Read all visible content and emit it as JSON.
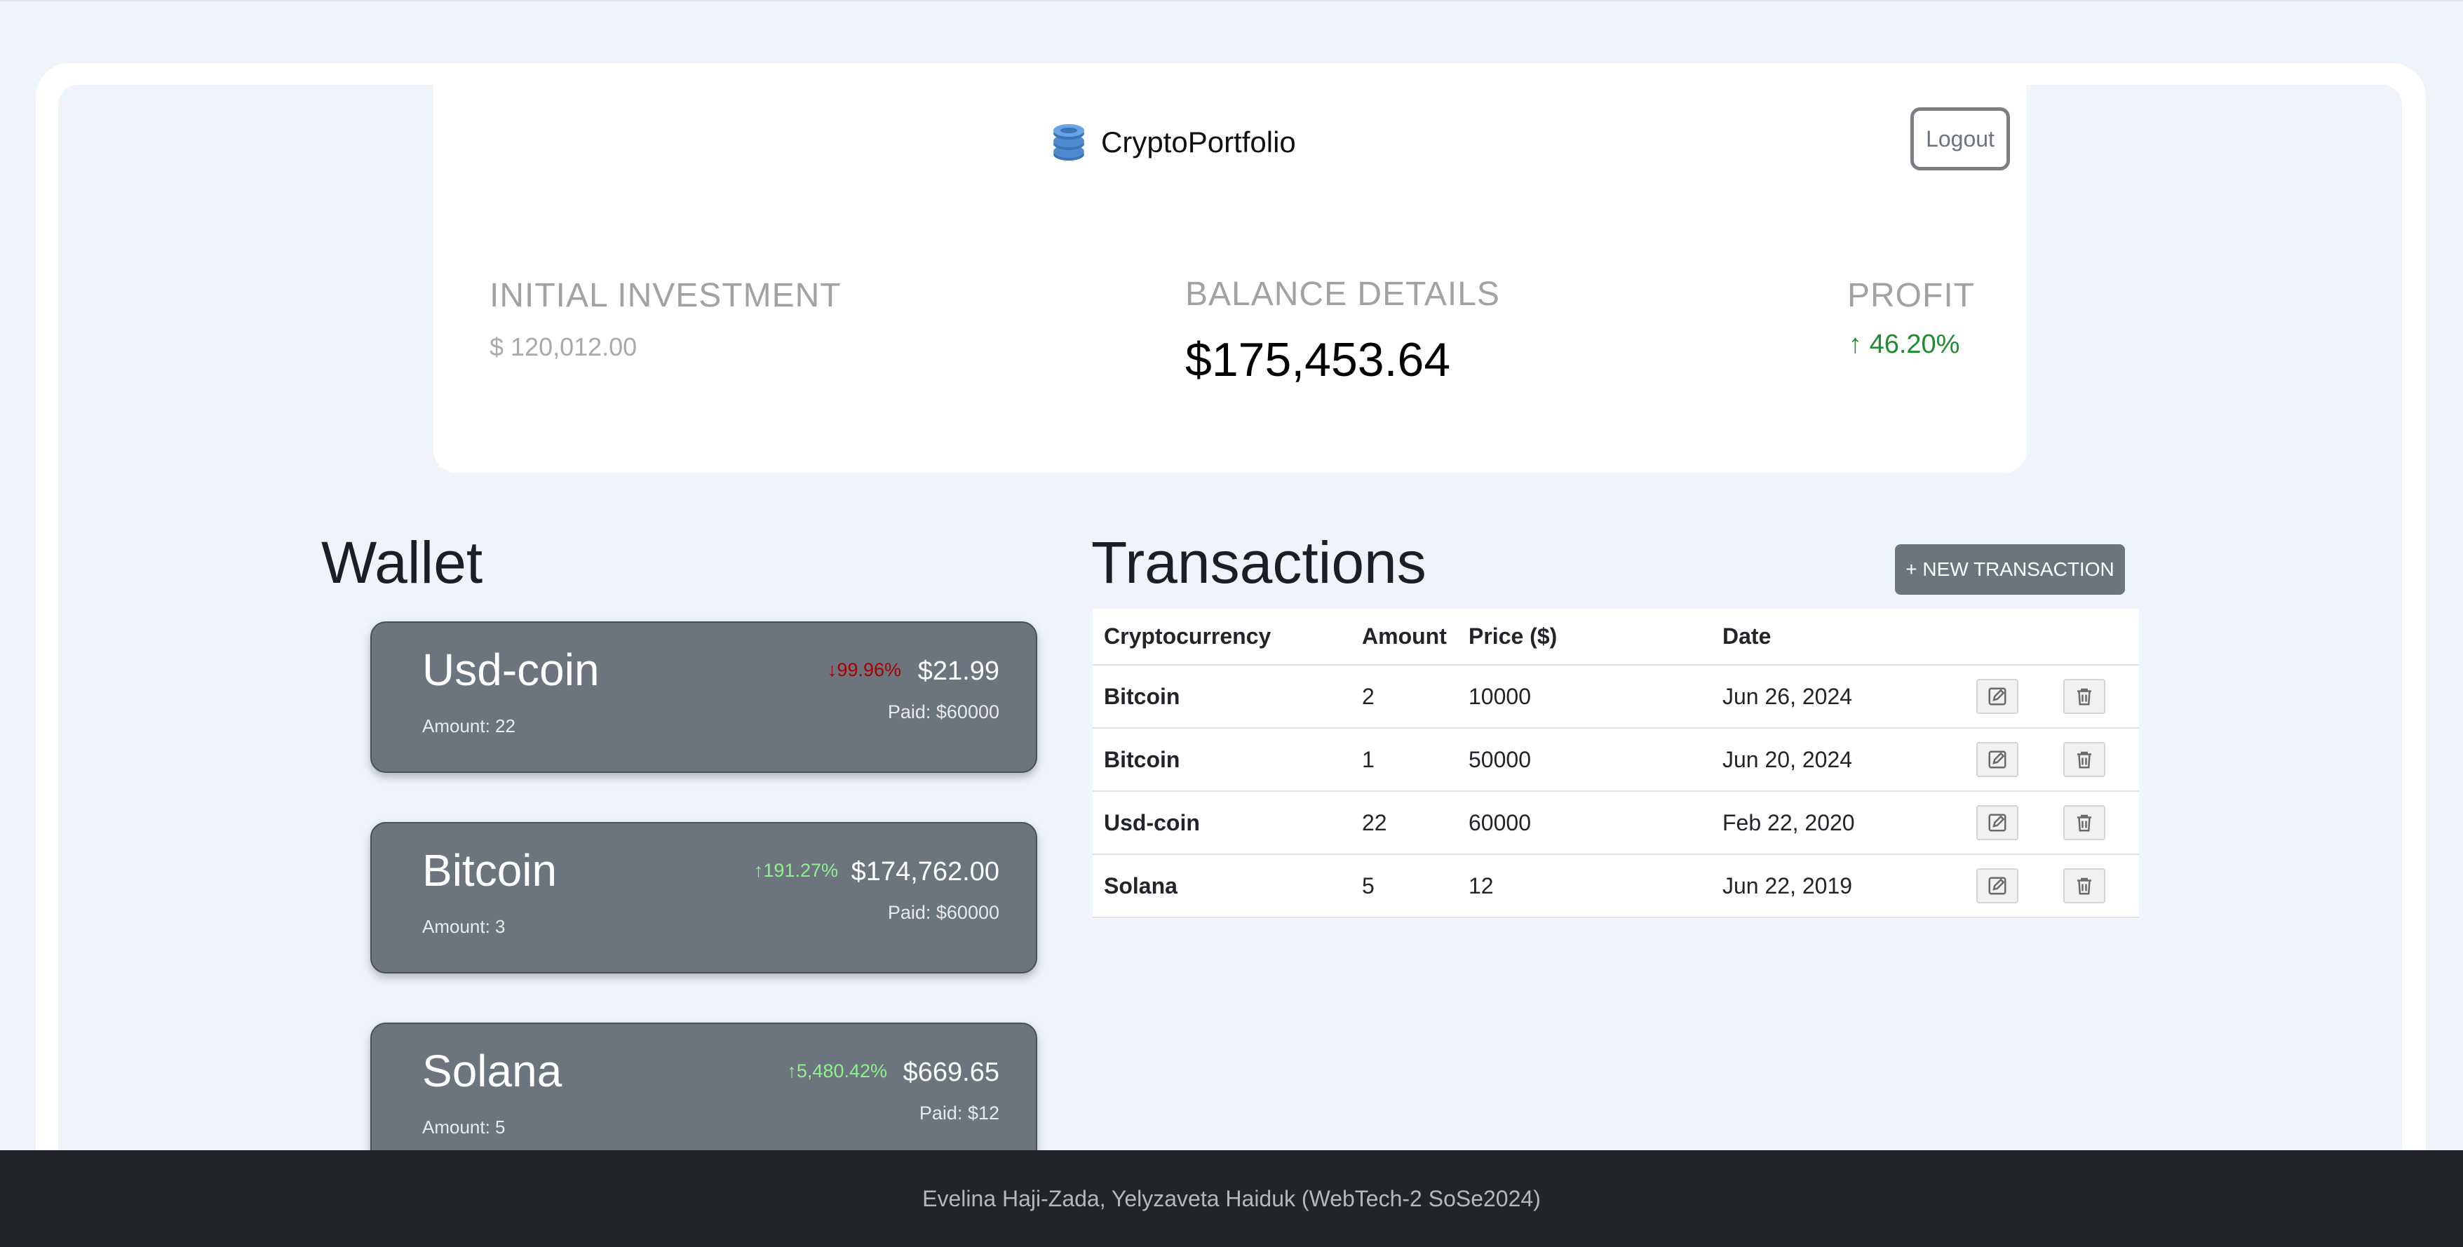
{
  "app": {
    "name": "CryptoPortfolio",
    "logout_label": "Logout"
  },
  "summary": {
    "initial_investment_label": "INITIAL INVESTMENT",
    "initial_investment_value": "$ 120,012.00",
    "balance_label": "BALANCE DETAILS",
    "balance_value": "$175,453.64",
    "profit_label": "PROFIT",
    "profit_arrow": "↑",
    "profit_value": "46.20%",
    "profit_color": "#1f8c2f"
  },
  "wallet": {
    "title": "Wallet",
    "items": [
      {
        "name": "Usd-coin",
        "amount": "Amount: 22",
        "change_arrow": "↓",
        "change": "99.96%",
        "direction": "down",
        "value": "$21.99",
        "paid": "Paid: $60000"
      },
      {
        "name": "Bitcoin",
        "amount": "Amount: 3",
        "change_arrow": "↑",
        "change": "191.27%",
        "direction": "up",
        "value": "$174,762.00",
        "paid": "Paid: $60000"
      },
      {
        "name": "Solana",
        "amount": "Amount: 5",
        "change_arrow": "↑",
        "change": "5,480.42%",
        "direction": "up",
        "value": "$669.65",
        "paid": "Paid: $12"
      }
    ]
  },
  "transactions": {
    "title": "Transactions",
    "new_button_label": "+ NEW TRANSACTION",
    "columns": [
      "Cryptocurrency",
      "Amount",
      "Price ($)",
      "Date"
    ],
    "rows": [
      {
        "crypto": "Bitcoin",
        "amount": "2",
        "price": "10000",
        "date": "Jun 26, 2024"
      },
      {
        "crypto": "Bitcoin",
        "amount": "1",
        "price": "50000",
        "date": "Jun 20, 2024"
      },
      {
        "crypto": "Usd-coin",
        "amount": "22",
        "price": "60000",
        "date": "Feb 22, 2020"
      },
      {
        "crypto": "Solana",
        "amount": "5",
        "price": "12",
        "date": "Jun 22, 2019"
      }
    ],
    "row_actions": [
      "edit-icon",
      "trash-icon"
    ]
  },
  "footer": {
    "text": "Evelina Haji-Zada, Yelyzaveta Haiduk (WebTech-2 SoSe2024)"
  },
  "colors": {
    "page_bg": "#eff3fa",
    "card_bg": "#6c757d",
    "footer_bg": "#212529",
    "loss": "#a80000",
    "gain": "#8ff08f"
  }
}
